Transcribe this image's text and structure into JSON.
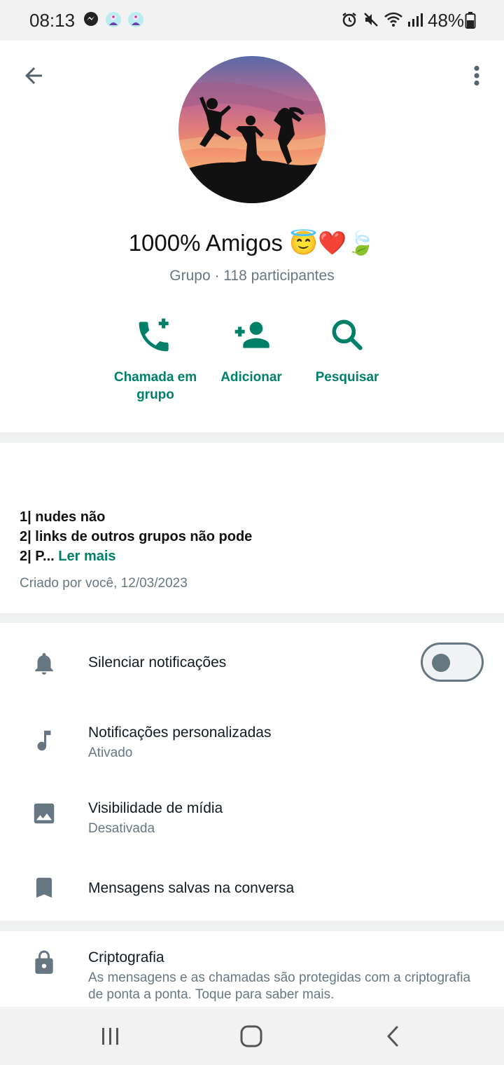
{
  "status_bar": {
    "time": "08:13",
    "battery": "48%",
    "icons": [
      "messenger-icon",
      "app-notification-icon",
      "app-notification-icon",
      "alarm-icon",
      "mute-icon",
      "wifi-icon",
      "signal-icon",
      "battery-icon"
    ]
  },
  "header": {
    "back_icon": "arrow-left-icon",
    "menu_icon": "more-vertical-icon"
  },
  "group": {
    "name": "1000% Amigos 😇❤️🍃",
    "subtitle": "Grupo · 118 participantes"
  },
  "actions": [
    {
      "label": "Chamada em grupo",
      "icon": "group-call-icon"
    },
    {
      "label": "Adicionar",
      "icon": "add-person-icon"
    },
    {
      "label": "Pesquisar",
      "icon": "search-icon"
    }
  ],
  "description": {
    "line1": "1| nudes não",
    "line2": "2| links de outros grupos não pode",
    "line3": "2| P...",
    "read_more": "Ler mais",
    "created": "Criado por você, 12/03/2023"
  },
  "settings": {
    "mute": {
      "title": "Silenciar notificações",
      "enabled": false,
      "icon": "bell-icon"
    },
    "custom_notifications": {
      "title": "Notificações personalizadas",
      "subtitle": "Ativado",
      "icon": "music-note-icon"
    },
    "media_visibility": {
      "title": "Visibilidade de mídia",
      "subtitle": "Desativada",
      "icon": "image-icon"
    },
    "saved_messages": {
      "title": "Mensagens salvas na conversa",
      "icon": "bookmark-icon"
    },
    "encryption": {
      "title": "Criptografia",
      "subtitle": "As mensagens e as chamadas são protegidas com a criptografia de ponta a ponta. Toque para saber mais.",
      "icon": "lock-icon"
    }
  },
  "colors": {
    "accent": "#008069",
    "secondary_text": "#667781",
    "icon_gray": "#8696a0"
  }
}
